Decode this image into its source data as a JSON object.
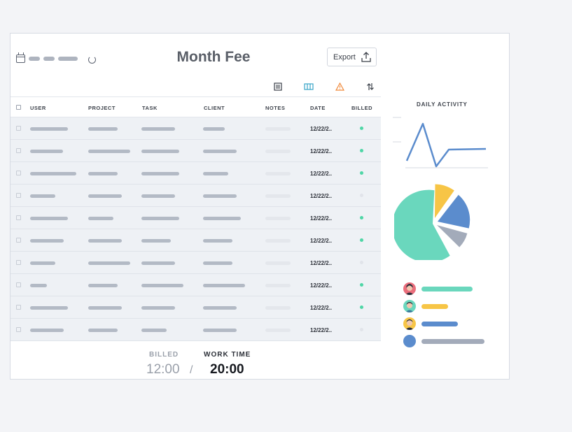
{
  "header": {
    "title": "Month Fee",
    "export_label": "Export"
  },
  "table": {
    "columns": [
      "USER",
      "PROJECT",
      "TASK",
      "CLIENT",
      "NOTES",
      "DATE",
      "BILLED"
    ],
    "rows": [
      {
        "date": "12/22/2..",
        "billed": true
      },
      {
        "date": "12/22/2..",
        "billed": true
      },
      {
        "date": "12/22/2..",
        "billed": true
      },
      {
        "date": "12/22/2..",
        "billed": false
      },
      {
        "date": "12/22/2..",
        "billed": true
      },
      {
        "date": "12/22/2..",
        "billed": true
      },
      {
        "date": "12/22/2..",
        "billed": false
      },
      {
        "date": "12/22/2..",
        "billed": true
      },
      {
        "date": "12/22/2..",
        "billed": true
      },
      {
        "date": "12/22/2..",
        "billed": false
      }
    ]
  },
  "footer": {
    "billed_label": "BILLED",
    "billed_value": "12:00",
    "separator": "/",
    "work_label": "WORK TIME",
    "work_value": "20:00"
  },
  "side": {
    "daily_title": "DAILY ACTIVITY"
  },
  "colors": {
    "billed_dot": "#4fd6a6",
    "unbilled_dot": "#e1e4ea",
    "line": "#5b8ccd",
    "pie": [
      "#6ad7bd",
      "#f7c546",
      "#5b8ccd",
      "#a3abba"
    ],
    "legend": [
      "#6ad7bd",
      "#f7c546",
      "#5b8ccd",
      "#a3abba"
    ]
  }
}
